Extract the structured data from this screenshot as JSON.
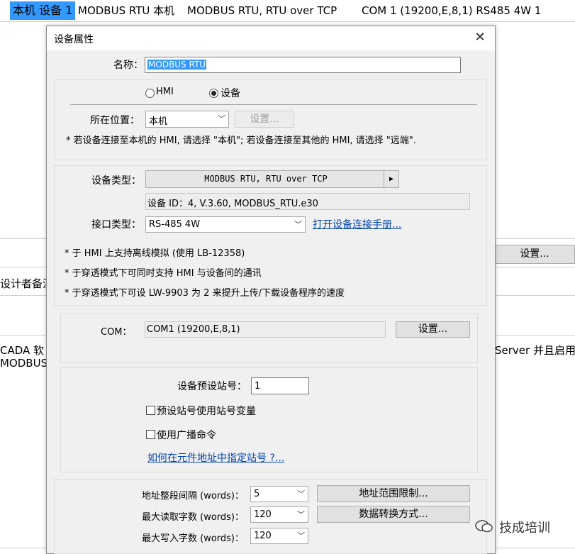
{
  "background": {
    "row1": {
      "selected": "本机 设备 1",
      "col2": "MODBUS RTU 本机",
      "col3": "MODBUS RTU, RTU over TCP",
      "col4": "COM 1 (19200,E,8,1) RS485 4W 1"
    },
    "settings_button": "设置...",
    "designer_note_fragment": "设计者备注",
    "scada_fragment": "CADA 软",
    "modbus_fragment": "MODBUS",
    "server_fragment": "Server 并且启用"
  },
  "dialog": {
    "title": "设备属性",
    "close_glyph": "✕",
    "name_label": "名称：",
    "name_value": "MODBUS RTU",
    "radio_hmi": "HMI",
    "radio_device": "设备",
    "selected_radio": "设备",
    "location_label": "所在位置：",
    "location_value": "本机",
    "location_settings": "设置...",
    "location_note": "* 若设备连接至本机的 HMI, 请选择 \"本机\"; 若设备连接至其他的 HMI, 请选择 \"远端\".",
    "device_type_label": "设备类型：",
    "device_type_value": "MODBUS RTU, RTU over TCP",
    "device_id": "设备 ID：4, V.3.60, MODBUS_RTU.e30",
    "interface_label": "接口类型：",
    "interface_value": "RS-485 4W",
    "manual_link": "打开设备连接手册...",
    "notes": [
      "* 于 HMI 上支持离线模拟 (使用 LB-12358)",
      "* 于穿透模式下可同时支持 HMI 与设备间的通讯",
      "* 于穿透模式下可设 LW-9903 为 2 来提升上传/下载设备程序的速度"
    ],
    "com_label": "COM：",
    "com_value": "COM1 (19200,E,8,1)",
    "com_settings": "设置...",
    "station_label": "设备预设站号：",
    "station_value": "1",
    "check_station_var": "预设站号使用站号变量",
    "check_broadcast": "使用广播命令",
    "station_link": "如何在元件地址中指定站号 ?...",
    "addr_gap_label": "地址整段间隔 (words)：",
    "addr_gap_value": "5",
    "addr_range_button": "地址范围限制...",
    "max_read_label": "最大读取字数 (words)：",
    "max_read_value": "120",
    "data_convert_button": "数据转换方式...",
    "max_write_label": "最大写入字数 (words)：",
    "max_write_value": "120"
  },
  "watermark": "技成培训",
  "icons": {
    "combo_arrow": "﹀",
    "play_arrow": "▶"
  }
}
